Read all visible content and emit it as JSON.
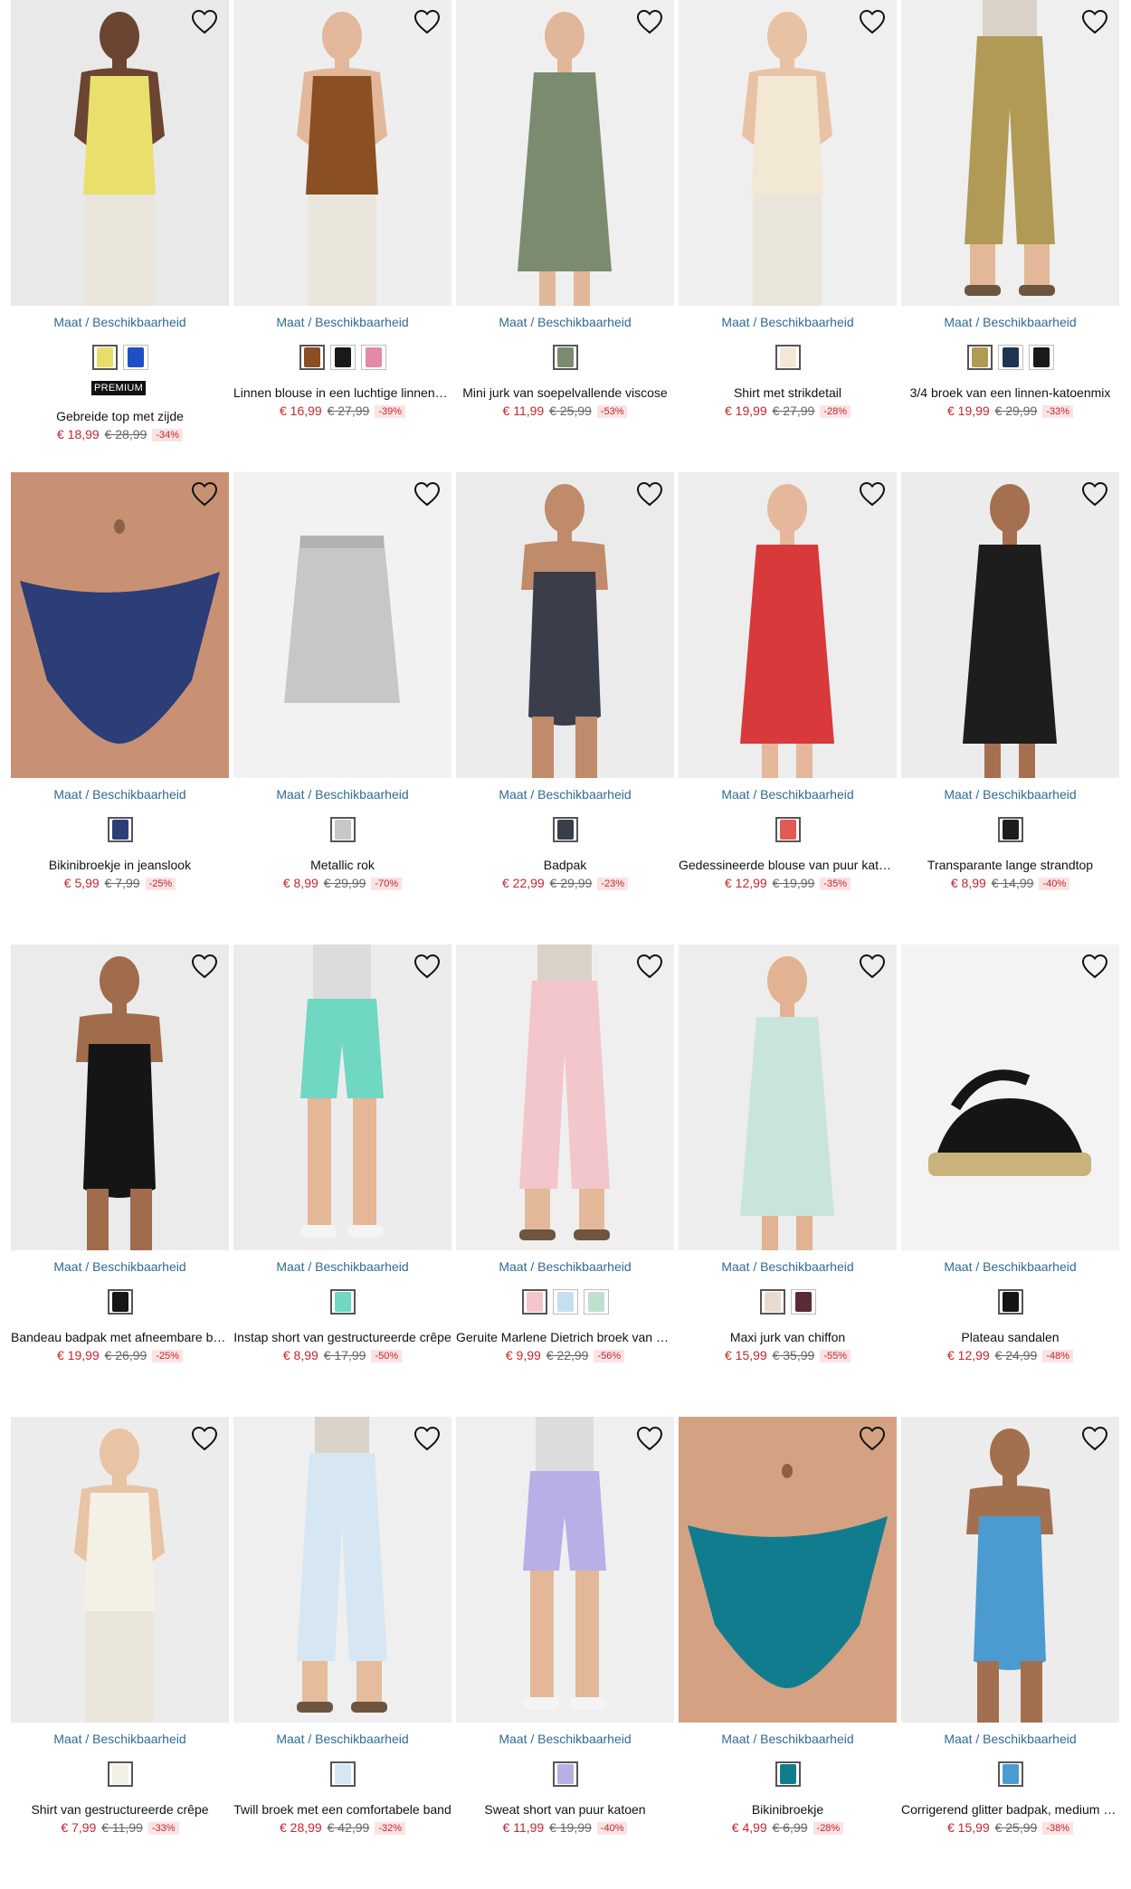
{
  "size_link_label": "Maat / Beschikbaarheid",
  "premium_label": "PREMIUM",
  "colors": {
    "price_new": "#c4262e",
    "size_link": "#2e6b92",
    "discount_bg": "#fbe3e3"
  },
  "products": [
    {
      "name": "Gebreide top met zijde",
      "price": "€ 18,99",
      "old_price": "€ 28,99",
      "discount": "-34%",
      "premium": true,
      "image": {
        "bg": "#e9e9e9",
        "garment": "#e8e06a",
        "skin": "#6b4432",
        "kind": "top"
      },
      "swatches": [
        "#e8dc6a",
        "#1f4fc4"
      ]
    },
    {
      "name": "Linnen blouse in een luchtige linnen-katoenmix",
      "price": "€ 16,99",
      "old_price": "€ 27,99",
      "discount": "-39%",
      "image": {
        "bg": "#eeeeee",
        "garment": "#8a4f22",
        "skin": "#e3b89a",
        "kind": "top"
      },
      "swatches": [
        "#8a4f22",
        "#1a1a1a",
        "#e58aa6"
      ]
    },
    {
      "name": "Mini jurk van soepelvallende viscose",
      "price": "€ 11,99",
      "old_price": "€ 25,99",
      "discount": "-53%",
      "image": {
        "bg": "#efefef",
        "garment": "#7b8b6f",
        "skin": "#e1b79a",
        "kind": "dress"
      },
      "swatches": [
        "#7b8b6f"
      ]
    },
    {
      "name": "Shirt met strikdetail",
      "price": "€ 19,99",
      "old_price": "€ 27,99",
      "discount": "-28%",
      "image": {
        "bg": "#efefef",
        "garment": "#f2e8d4",
        "skin": "#e8c2a4",
        "kind": "top"
      },
      "swatches": [
        "#f2e8d4"
      ]
    },
    {
      "name": "3/4 broek van een linnen-katoenmix",
      "price": "€ 19,99",
      "old_price": "€ 29,99",
      "discount": "-33%",
      "image": {
        "bg": "#efefef",
        "garment": "#b19a55",
        "skin": "#e2b898",
        "kind": "pants"
      },
      "swatches": [
        "#b19a55",
        "#1f3552",
        "#1a1a1a"
      ]
    },
    {
      "name": "Bikinibroekje in jeanslook",
      "price": "€ 5,99",
      "old_price": "€ 7,99",
      "discount": "-25%",
      "image": {
        "bg": "#e2d9d0",
        "garment": "#2c3d78",
        "skin": "#c99173",
        "kind": "bikini"
      },
      "swatches": [
        "#2c3d78"
      ]
    },
    {
      "name": "Metallic rok",
      "price": "€ 8,99",
      "old_price": "€ 29,99",
      "discount": "-70%",
      "image": {
        "bg": "#f2f2f2",
        "garment": "#c7c7c7",
        "skin": "#f2f2f2",
        "kind": "skirt"
      },
      "swatches": [
        "#c7c7c7"
      ]
    },
    {
      "name": "Badpak",
      "price": "€ 22,99",
      "old_price": "€ 29,99",
      "discount": "-23%",
      "image": {
        "bg": "#ebebeb",
        "garment": "#3a3d4a",
        "skin": "#c08b6a",
        "kind": "swimsuit"
      },
      "swatches": [
        "#3a3d4a"
      ]
    },
    {
      "name": "Gedessineerde blouse van puur katoen",
      "price": "€ 12,99",
      "old_price": "€ 19,99",
      "discount": "-35%",
      "image": {
        "bg": "#ededed",
        "garment": "#d8393b",
        "skin": "#e6b89b",
        "kind": "dress"
      },
      "swatches": [
        "#e25a55"
      ]
    },
    {
      "name": "Transparante lange strandtop",
      "price": "€ 8,99",
      "old_price": "€ 14,99",
      "discount": "-40%",
      "image": {
        "bg": "#ececec",
        "garment": "#1d1d1d",
        "skin": "#a5704f",
        "kind": "dress"
      },
      "swatches": [
        "#1d1d1d"
      ]
    },
    {
      "name": "Bandeau badpak met afneembare bandjes",
      "price": "€ 19,99",
      "old_price": "€ 26,99",
      "discount": "-25%",
      "image": {
        "bg": "#ebebeb",
        "garment": "#151515",
        "skin": "#a06c4c",
        "kind": "swimsuit"
      },
      "swatches": [
        "#151515"
      ]
    },
    {
      "name": "Instap short van gestructureerde crêpe",
      "price": "€ 8,99",
      "old_price": "€ 17,99",
      "discount": "-50%",
      "image": {
        "bg": "#ececec",
        "garment": "#6fd7c2",
        "skin": "#e5b797",
        "kind": "shorts"
      },
      "swatches": [
        "#6fd7c2"
      ]
    },
    {
      "name": "Geruite Marlene Dietrich broek van viscose",
      "price": "€ 9,99",
      "old_price": "€ 22,99",
      "discount": "-56%",
      "image": {
        "bg": "#efefef",
        "garment": "#f3c6cc",
        "skin": "#e3b999",
        "kind": "pants"
      },
      "swatches": [
        "#f3c6cc",
        "#c6dff0",
        "#bfe0cc"
      ]
    },
    {
      "name": "Maxi jurk van chiffon",
      "price": "€ 15,99",
      "old_price": "€ 35,99",
      "discount": "-55%",
      "image": {
        "bg": "#ededed",
        "garment": "#c9e4dd",
        "skin": "#e1b392",
        "kind": "dress"
      },
      "swatches": [
        "#e8dcd0",
        "#5a2a35"
      ]
    },
    {
      "name": "Plateau sandalen",
      "price": "€ 12,99",
      "old_price": "€ 24,99",
      "discount": "-48%",
      "image": {
        "bg": "#f3f3f3",
        "garment": "#151515",
        "skin": "#f3f3f3",
        "kind": "shoe"
      },
      "swatches": [
        "#151515"
      ]
    },
    {
      "name": "Shirt van gestructureerde crêpe",
      "price": "€ 7,99",
      "old_price": "€ 11,99",
      "discount": "-33%",
      "image": {
        "bg": "#ececec",
        "garment": "#f3f0e6",
        "skin": "#e8c3a4",
        "kind": "top"
      },
      "swatches": [
        "#f3f0e6"
      ]
    },
    {
      "name": "Twill broek met een comfortabele band",
      "price": "€ 28,99",
      "old_price": "€ 42,99",
      "discount": "-32%",
      "image": {
        "bg": "#efefef",
        "garment": "#d6e6f2",
        "skin": "#e5bd9d",
        "kind": "pants"
      },
      "swatches": [
        "#d6e6f2"
      ]
    },
    {
      "name": "Sweat short van puur katoen",
      "price": "€ 11,99",
      "old_price": "€ 19,99",
      "discount": "-40%",
      "image": {
        "bg": "#efefef",
        "garment": "#b9aee6",
        "skin": "#e2b898",
        "kind": "shorts"
      },
      "swatches": [
        "#b9aee6"
      ]
    },
    {
      "name": "Bikinibroekje",
      "price": "€ 4,99",
      "old_price": "€ 6,99",
      "discount": "-28%",
      "image": {
        "bg": "#e4ddd6",
        "garment": "#127c8f",
        "skin": "#d4a283",
        "kind": "bikini"
      },
      "swatches": [
        "#127c8f"
      ]
    },
    {
      "name": "Corrigerend glitter badpak, medium shaping",
      "price": "€ 15,99",
      "old_price": "€ 25,99",
      "discount": "-38%",
      "image": {
        "bg": "#ececec",
        "garment": "#4b9bd1",
        "skin": "#a3704f",
        "kind": "swimsuit"
      },
      "swatches": [
        "#4b9bd1"
      ]
    }
  ]
}
